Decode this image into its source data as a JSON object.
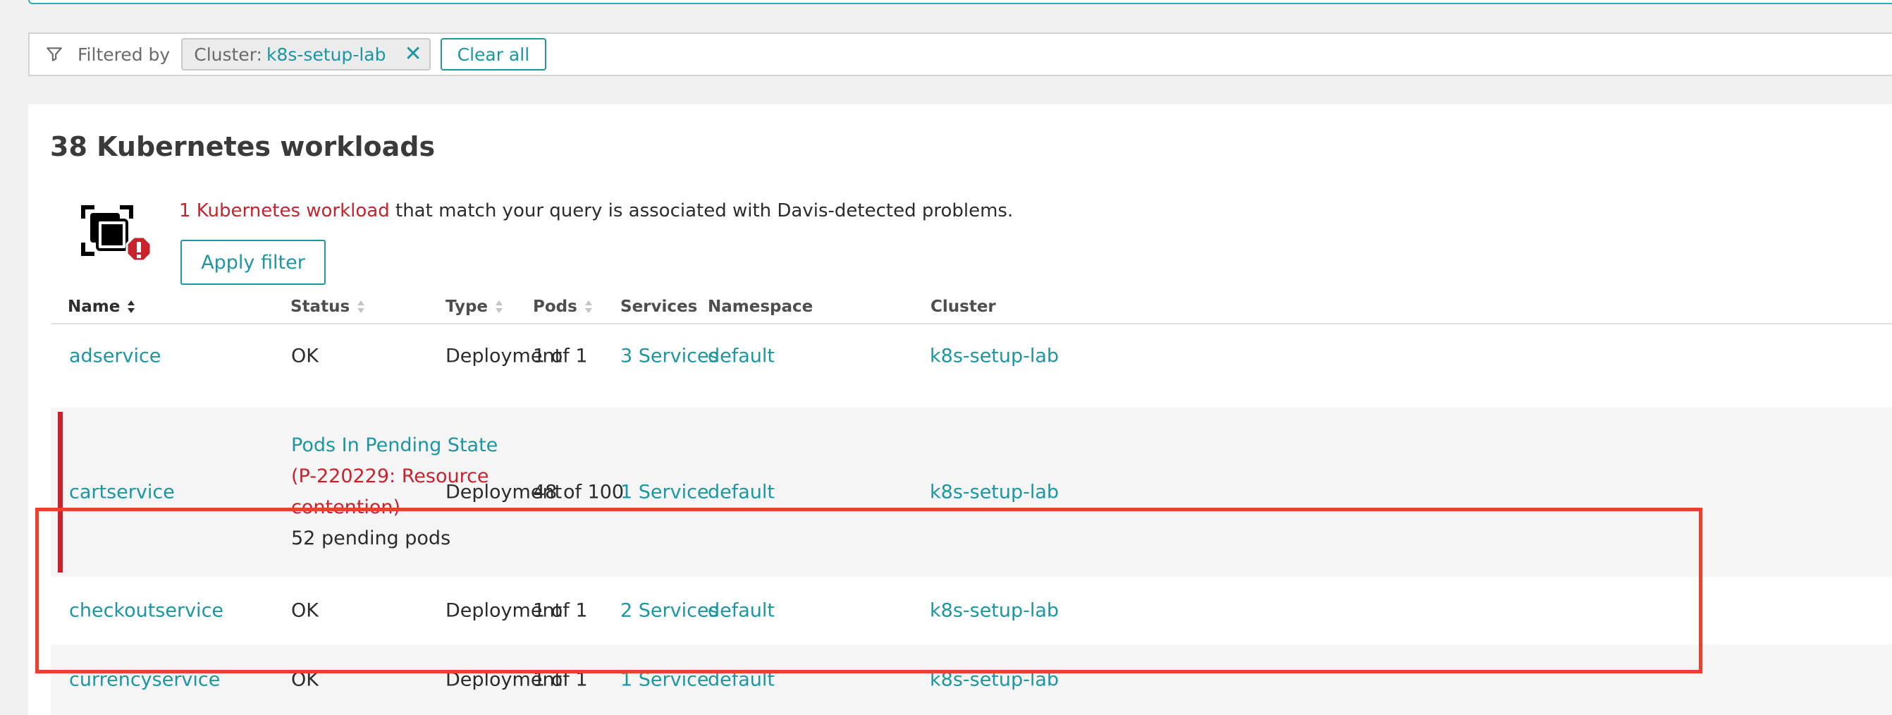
{
  "filter": {
    "label": "Filtered by",
    "chip_key": "Cluster:",
    "chip_value": "k8s-setup-lab",
    "chip_remove": "✕",
    "clear_label": "Clear all"
  },
  "panel": {
    "title": "38 Kubernetes workloads",
    "alert_link": "1 Kubernetes workload",
    "alert_rest": " that match your query is associated with Davis-detected problems.",
    "apply_label": "Apply filter"
  },
  "table": {
    "headers": {
      "name": "Name",
      "status": "Status",
      "type": "Type",
      "pods": "Pods",
      "services": "Services",
      "namespace": "Namespace",
      "cluster": "Cluster"
    },
    "rows": [
      {
        "name": "adservice",
        "status": "OK",
        "type": "Deployment",
        "pods": "1 of 1",
        "services": "3 Services",
        "namespace": "default",
        "cluster": "k8s-setup-lab"
      },
      {
        "name": "cartservice",
        "status_title": "Pods In Pending State",
        "status_problem_line1": "(P-220229: Resource",
        "status_problem_line2": "contention)",
        "status_detail": "52 pending pods",
        "type": "Deployment",
        "pods": "48 of 100",
        "services": "1 Service",
        "namespace": "default",
        "cluster": "k8s-setup-lab"
      },
      {
        "name": "checkoutservice",
        "status": "OK",
        "type": "Deployment",
        "pods": "1 of 1",
        "services": "2 Services",
        "namespace": "default",
        "cluster": "k8s-setup-lab"
      },
      {
        "name": "currencyservice",
        "status": "OK",
        "type": "Deployment",
        "pods": "1 of 1",
        "services": "1 Service",
        "namespace": "default",
        "cluster": "k8s-setup-lab"
      }
    ]
  },
  "colors": {
    "accent": "#1b96a3",
    "problem": "#c8232c",
    "highlight": "#e4442e"
  }
}
